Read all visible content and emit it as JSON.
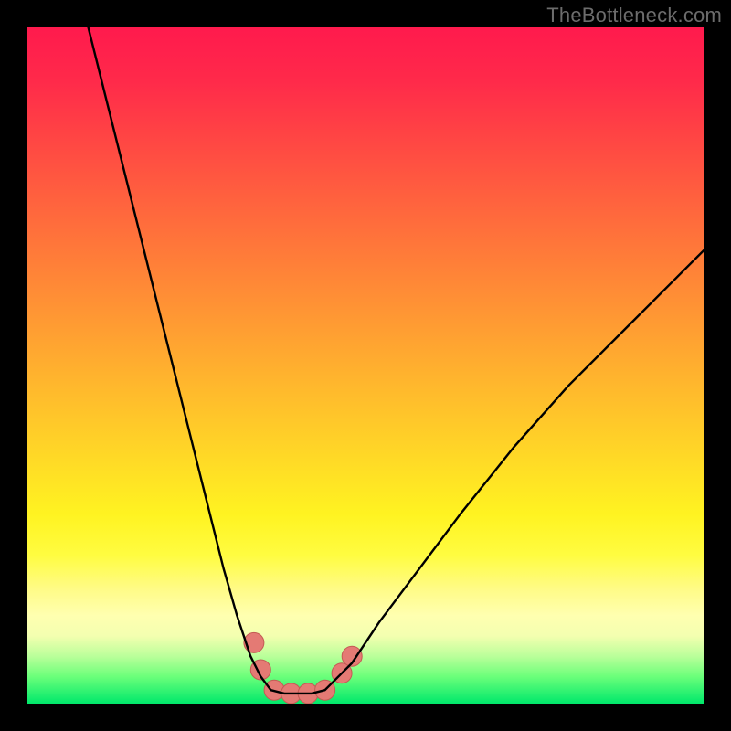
{
  "watermark": {
    "text": "TheBottleneck.com"
  },
  "colors": {
    "frame": "#000000",
    "curve_stroke": "#000000",
    "marker_fill": "#e47a74",
    "marker_stroke": "#c45a54"
  },
  "chart_data": {
    "type": "line",
    "title": "",
    "xlabel": "",
    "ylabel": "",
    "xlim": [
      0,
      100
    ],
    "ylim": [
      0,
      100
    ],
    "grid": false,
    "legend": false,
    "series": [
      {
        "name": "left-branch",
        "x": [
          9,
          12,
          15,
          18,
          21,
          24,
          27,
          29,
          31,
          33,
          34.5,
          36
        ],
        "y": [
          100,
          88,
          76,
          64,
          52,
          40,
          28,
          20,
          13,
          7,
          4,
          2
        ]
      },
      {
        "name": "flat-minimum",
        "x": [
          36,
          38,
          40,
          42,
          44
        ],
        "y": [
          2,
          1.5,
          1.5,
          1.5,
          2
        ]
      },
      {
        "name": "right-branch",
        "x": [
          44,
          48,
          52,
          58,
          64,
          72,
          80,
          88,
          96,
          100
        ],
        "y": [
          2,
          6,
          12,
          20,
          28,
          38,
          47,
          55,
          63,
          67
        ]
      }
    ],
    "markers": {
      "name": "highlight-points",
      "points": [
        {
          "x": 33.5,
          "y": 9
        },
        {
          "x": 34.5,
          "y": 5
        },
        {
          "x": 36.5,
          "y": 2
        },
        {
          "x": 39,
          "y": 1.5
        },
        {
          "x": 41.5,
          "y": 1.5
        },
        {
          "x": 44,
          "y": 2
        },
        {
          "x": 46.5,
          "y": 4.5
        },
        {
          "x": 48,
          "y": 7
        }
      ],
      "radius": 11
    },
    "background_gradient": {
      "top": "#ff1a4d",
      "mid": "#ffda26",
      "bottom": "#00e86b"
    }
  }
}
